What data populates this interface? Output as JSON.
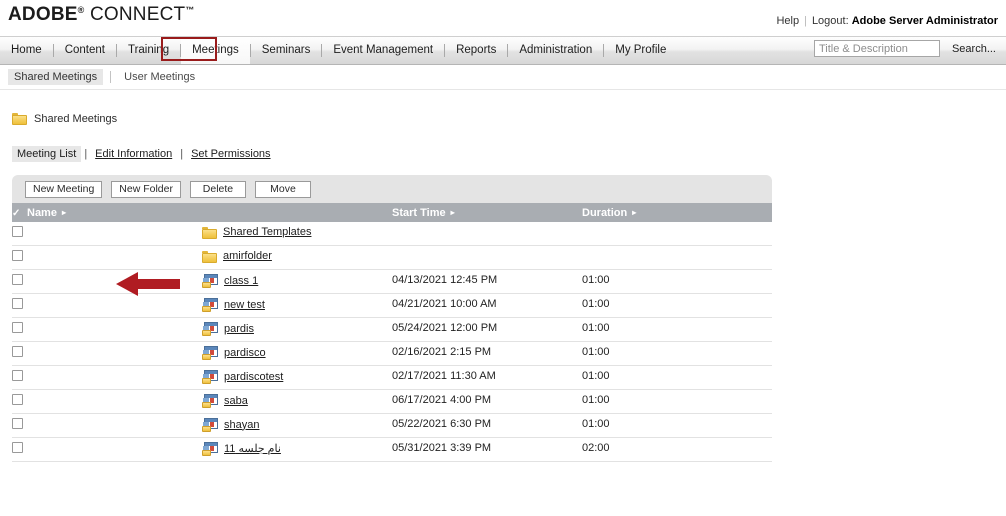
{
  "brand": {
    "name_bold": "ADOBE",
    "registered": "®",
    "name_light": " CONNECT",
    "trademark": "™"
  },
  "topbar": {
    "help": "Help",
    "logout_label": "Logout:",
    "user": "Adobe Server Administrator"
  },
  "nav": {
    "items": [
      {
        "label": "Home",
        "active": false
      },
      {
        "label": "Content",
        "active": false
      },
      {
        "label": "Training",
        "active": false
      },
      {
        "label": "Meetings",
        "active": true
      },
      {
        "label": "Seminars",
        "active": false
      },
      {
        "label": "Event Management",
        "active": false
      },
      {
        "label": "Reports",
        "active": false
      },
      {
        "label": "Administration",
        "active": false
      },
      {
        "label": "My Profile",
        "active": false
      }
    ]
  },
  "search": {
    "placeholder": "Title & Description",
    "value": "",
    "button": "Search..."
  },
  "subnav": {
    "items": [
      {
        "label": "Shared Meetings",
        "active": true
      },
      {
        "label": "User Meetings",
        "active": false
      }
    ]
  },
  "breadcrumb": {
    "icon": "folder-icon",
    "label": "Shared Meetings"
  },
  "tabs": {
    "meeting_list": "Meeting List",
    "edit_information": "Edit Information",
    "set_permissions": "Set Permissions",
    "separator": "|"
  },
  "toolbar": {
    "new_meeting": "New Meeting",
    "new_folder": "New Folder",
    "delete": "Delete",
    "move": "Move"
  },
  "table": {
    "headers": {
      "select_all_icon": "check-icon",
      "name": "Name",
      "start_time": "Start Time",
      "duration": "Duration",
      "sort_arrow": "▸"
    },
    "rows": [
      {
        "icon": "folder-icon",
        "name": "Shared Templates",
        "start_time": "",
        "duration": "",
        "rtl": false
      },
      {
        "icon": "folder-icon",
        "name": "amirfolder",
        "start_time": "",
        "duration": "",
        "rtl": false
      },
      {
        "icon": "meeting-icon",
        "name": "class 1",
        "start_time": "04/13/2021 12:45 PM",
        "duration": "01:00",
        "rtl": false
      },
      {
        "icon": "meeting-icon",
        "name": "new test",
        "start_time": "04/21/2021 10:00 AM",
        "duration": "01:00",
        "rtl": false
      },
      {
        "icon": "meeting-icon",
        "name": "pardis",
        "start_time": "05/24/2021 12:00 PM",
        "duration": "01:00",
        "rtl": false
      },
      {
        "icon": "meeting-icon",
        "name": "pardisco",
        "start_time": "02/16/2021 2:15 PM",
        "duration": "01:00",
        "rtl": false
      },
      {
        "icon": "meeting-icon",
        "name": "pardiscotest",
        "start_time": "02/17/2021 11:30 AM",
        "duration": "01:00",
        "rtl": false
      },
      {
        "icon": "meeting-icon",
        "name": "saba",
        "start_time": "06/17/2021 4:00 PM",
        "duration": "01:00",
        "rtl": false
      },
      {
        "icon": "meeting-icon",
        "name": "shayan",
        "start_time": "05/22/2021 6:30 PM",
        "duration": "01:00",
        "rtl": false
      },
      {
        "icon": "meeting-icon",
        "name": "نام جلسه 11",
        "start_time": "05/31/2021 3:39 PM",
        "duration": "02:00",
        "rtl": true
      }
    ]
  },
  "annotations": {
    "highlight_color": "#991b1b",
    "arrow_color": "#b01c22",
    "highlight_target": "Meetings",
    "arrow_target": "class 1"
  }
}
